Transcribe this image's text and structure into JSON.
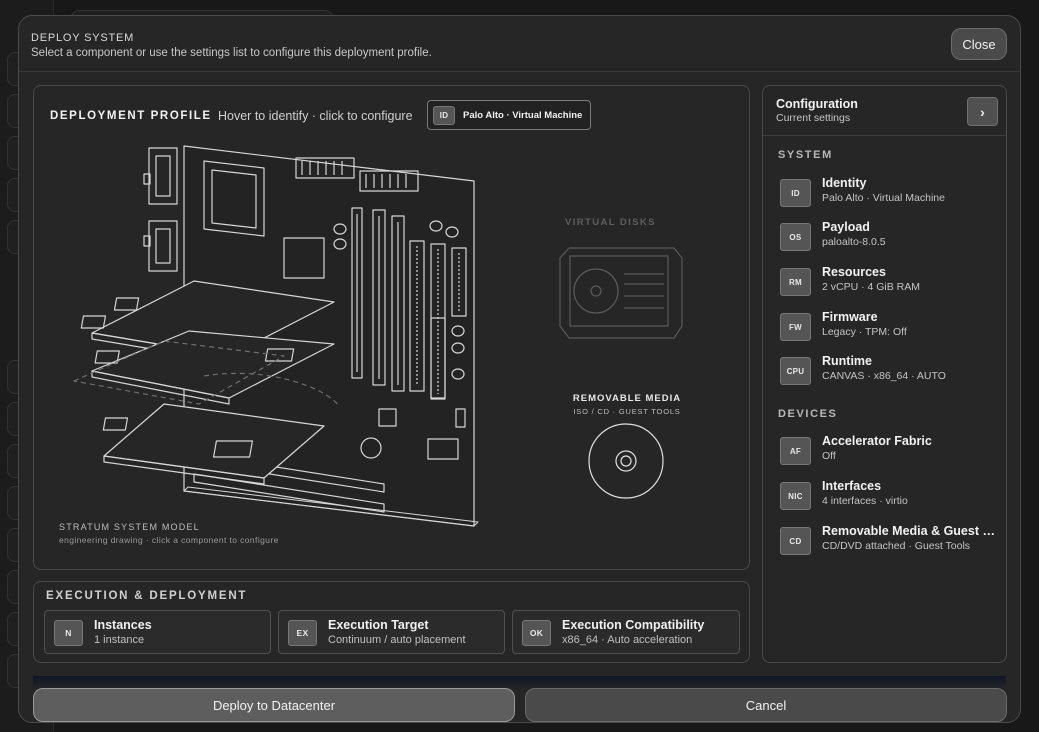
{
  "modal": {
    "title": "DEPLOY SYSTEM",
    "subtitle": "Select a component or use the settings list to configure this deployment profile.",
    "close_label": "Close"
  },
  "profile": {
    "title": "DEPLOYMENT PROFILE",
    "hint": "Hover to identify · click to configure",
    "tag_badge": "ID",
    "tag_label": "Palo Alto · Virtual Machine",
    "virtual_disks_label": "VIRTUAL DISKS",
    "removable_media_label": "REMOVABLE MEDIA",
    "removable_media_sub": "ISO / CD · GUEST TOOLS",
    "model_title": "STRATUM SYSTEM MODEL",
    "model_sub": "engineering drawing · click a component to configure"
  },
  "execution": {
    "title": "EXECUTION & DEPLOYMENT",
    "cards": [
      {
        "badge": "N",
        "title": "Instances",
        "value": "1 instance"
      },
      {
        "badge": "EX",
        "title": "Execution Target",
        "value": "Continuum / auto placement"
      },
      {
        "badge": "OK",
        "title": "Execution Compatibility",
        "value": "x86_64 · Auto acceleration"
      }
    ]
  },
  "config": {
    "title": "Configuration",
    "subtitle": "Current settings",
    "arrow": "›",
    "system_label": "SYSTEM",
    "system_items": [
      {
        "badge": "ID",
        "name": "Identity",
        "value": "Palo Alto · Virtual Machine"
      },
      {
        "badge": "OS",
        "name": "Payload",
        "value": "paloalto-8.0.5"
      },
      {
        "badge": "RM",
        "name": "Resources",
        "value": "2 vCPU · 4 GiB RAM"
      },
      {
        "badge": "FW",
        "name": "Firmware",
        "value": "Legacy · TPM: Off"
      },
      {
        "badge": "CPU",
        "name": "Runtime",
        "value": "CANVAS · x86_64 · AUTO"
      }
    ],
    "devices_label": "DEVICES",
    "device_items": [
      {
        "badge": "AF",
        "name": "Accelerator Fabric",
        "value": "Off"
      },
      {
        "badge": "NIC",
        "name": "Interfaces",
        "value": "4 interfaces · virtio"
      },
      {
        "badge": "CD",
        "name": "Removable Media & Guest Tools",
        "value": "CD/DVD attached · Guest Tools"
      }
    ]
  },
  "footer": {
    "deploy_label": "Deploy to Datacenter",
    "cancel_label": "Cancel"
  }
}
